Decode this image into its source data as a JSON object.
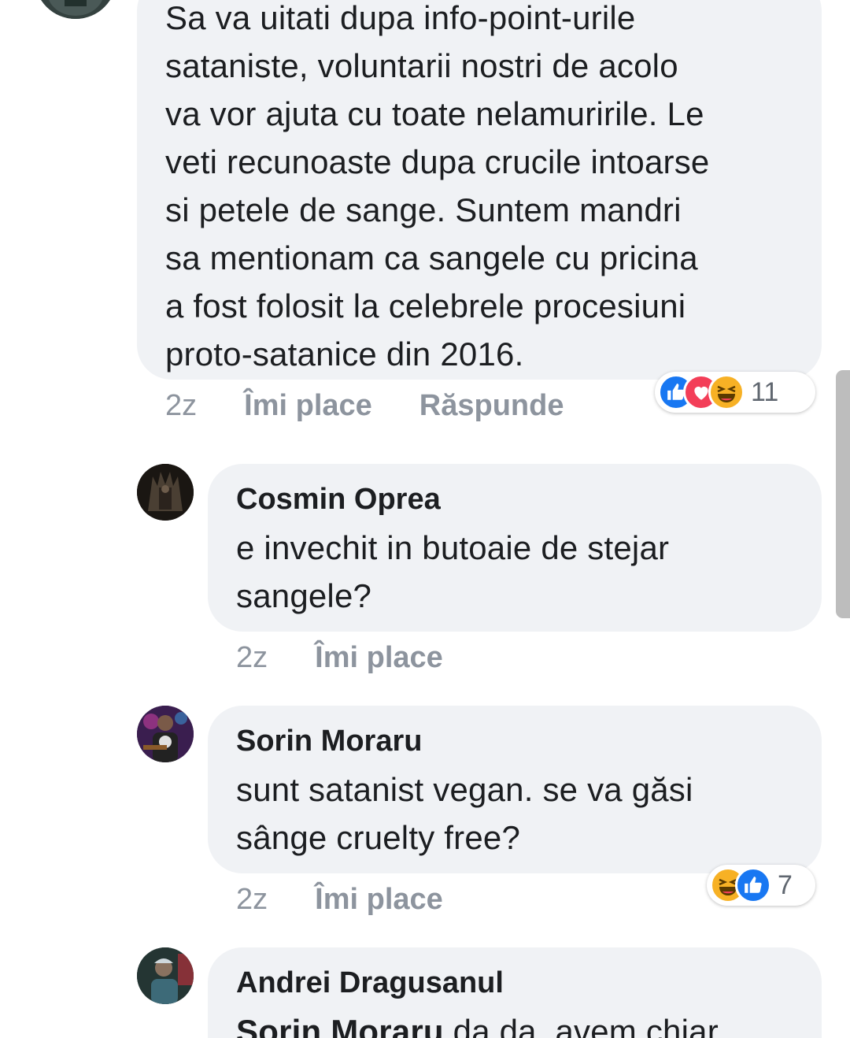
{
  "comments": [
    {
      "lines": [
        "Sa va uitati dupa info-point-urile",
        "sataniste, voluntarii nostri de acolo",
        "va vor ajuta cu toate nelamuririle. Le",
        "veti recunoaste dupa crucile intoarse",
        "si petele de sange. Suntem mandri",
        "sa mentionam ca sangele cu pricina",
        "a fost folosit la celebrele procesiuni",
        "proto-satanice din 2016."
      ],
      "time": "2z",
      "like_label": "Îmi place",
      "reply_label": "Răspunde",
      "reactions": [
        "like-icon",
        "love-icon",
        "haha-icon"
      ],
      "reaction_count": "11"
    },
    {
      "author": "Cosmin Oprea",
      "lines": [
        "e invechit in butoaie de stejar",
        "sangele?"
      ],
      "time": "2z",
      "like_label": "Îmi place"
    },
    {
      "author": "Sorin Moraru",
      "lines": [
        "sunt satanist vegan. se va găsi",
        "sânge cruelty free?"
      ],
      "time": "2z",
      "like_label": "Îmi place",
      "reactions": [
        "haha-icon",
        "like-icon"
      ],
      "reaction_count": "7"
    },
    {
      "author": "Andrei Dragusanul",
      "mention": "Sorin Moraru",
      "text": " da da, avem chiar"
    }
  ],
  "colors": {
    "like": "#1877f2",
    "love": "#f33e58",
    "haha": "#f7b125",
    "bubble": "#f0f2f5",
    "meta": "#8d949e"
  }
}
